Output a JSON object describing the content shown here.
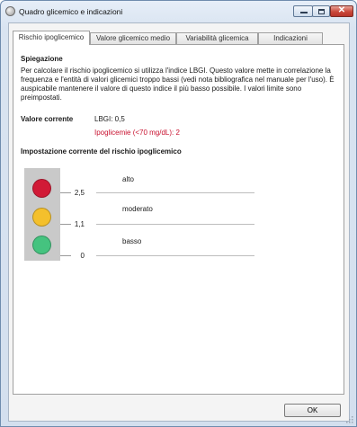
{
  "window": {
    "title": "Quadro glicemico e indicazioni",
    "controls": [
      "minimize",
      "maximize",
      "close"
    ],
    "close_glyph": "✕"
  },
  "tabs": [
    {
      "label": "Rischio ipoglicemico",
      "active": true
    },
    {
      "label": "Valore glicemico medio",
      "active": false
    },
    {
      "label": "Variabilità glicemica",
      "active": false
    },
    {
      "label": "Indicazioni",
      "active": false
    }
  ],
  "panel": {
    "explanation_heading": "Spiegazione",
    "explanation_text": "Per calcolare il rischio ipoglicemico si utilizza l'indice LBGI. Questo valore mette in correlazione la frequenza e l'entità di valori glicemici troppo bassi (vedi nota bibliografica nel manuale per l'uso). È auspicabile mantenere il valore di questo indice il più basso possibile. I valori limite sono preimpostati.",
    "current_value_label": "Valore corrente",
    "lbgi_value": "LBGI: 0,5",
    "hypo_count": "Ipoglicemie (<70 mg/dL): 2",
    "setting_heading": "Impostazione corrente del rischio ipoglicemico",
    "levels": [
      {
        "label": "alto",
        "color": "#d11a36"
      },
      {
        "label": "moderato",
        "color": "#f4c02c"
      },
      {
        "label": "basso",
        "color": "#45c37f"
      }
    ],
    "thresholds": [
      "2,5",
      "1,1",
      "0"
    ]
  },
  "footer": {
    "ok_label": "OK"
  },
  "colors": {
    "accent_red": "#c8102e",
    "titlebar": "#d9e4f1"
  }
}
